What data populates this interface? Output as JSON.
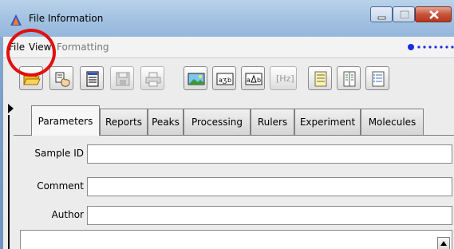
{
  "window": {
    "title": "File Information"
  },
  "menubar": {
    "items": [
      "File",
      "View",
      "Formatting"
    ]
  },
  "toolbar": {
    "hz_label": "[Hz]"
  },
  "tabs": [
    "Parameters",
    "Reports",
    "Peaks",
    "Processing",
    "Rulers",
    "Experiment",
    "Molecules"
  ],
  "form": {
    "sample_id_label": "Sample ID",
    "sample_id_value": "",
    "comment_label": "Comment",
    "comment_value": "",
    "author_label": "Author",
    "author_value": ""
  },
  "colors": {
    "highlight_circle": "#e01010",
    "progress_dots": "#1b2be6"
  }
}
